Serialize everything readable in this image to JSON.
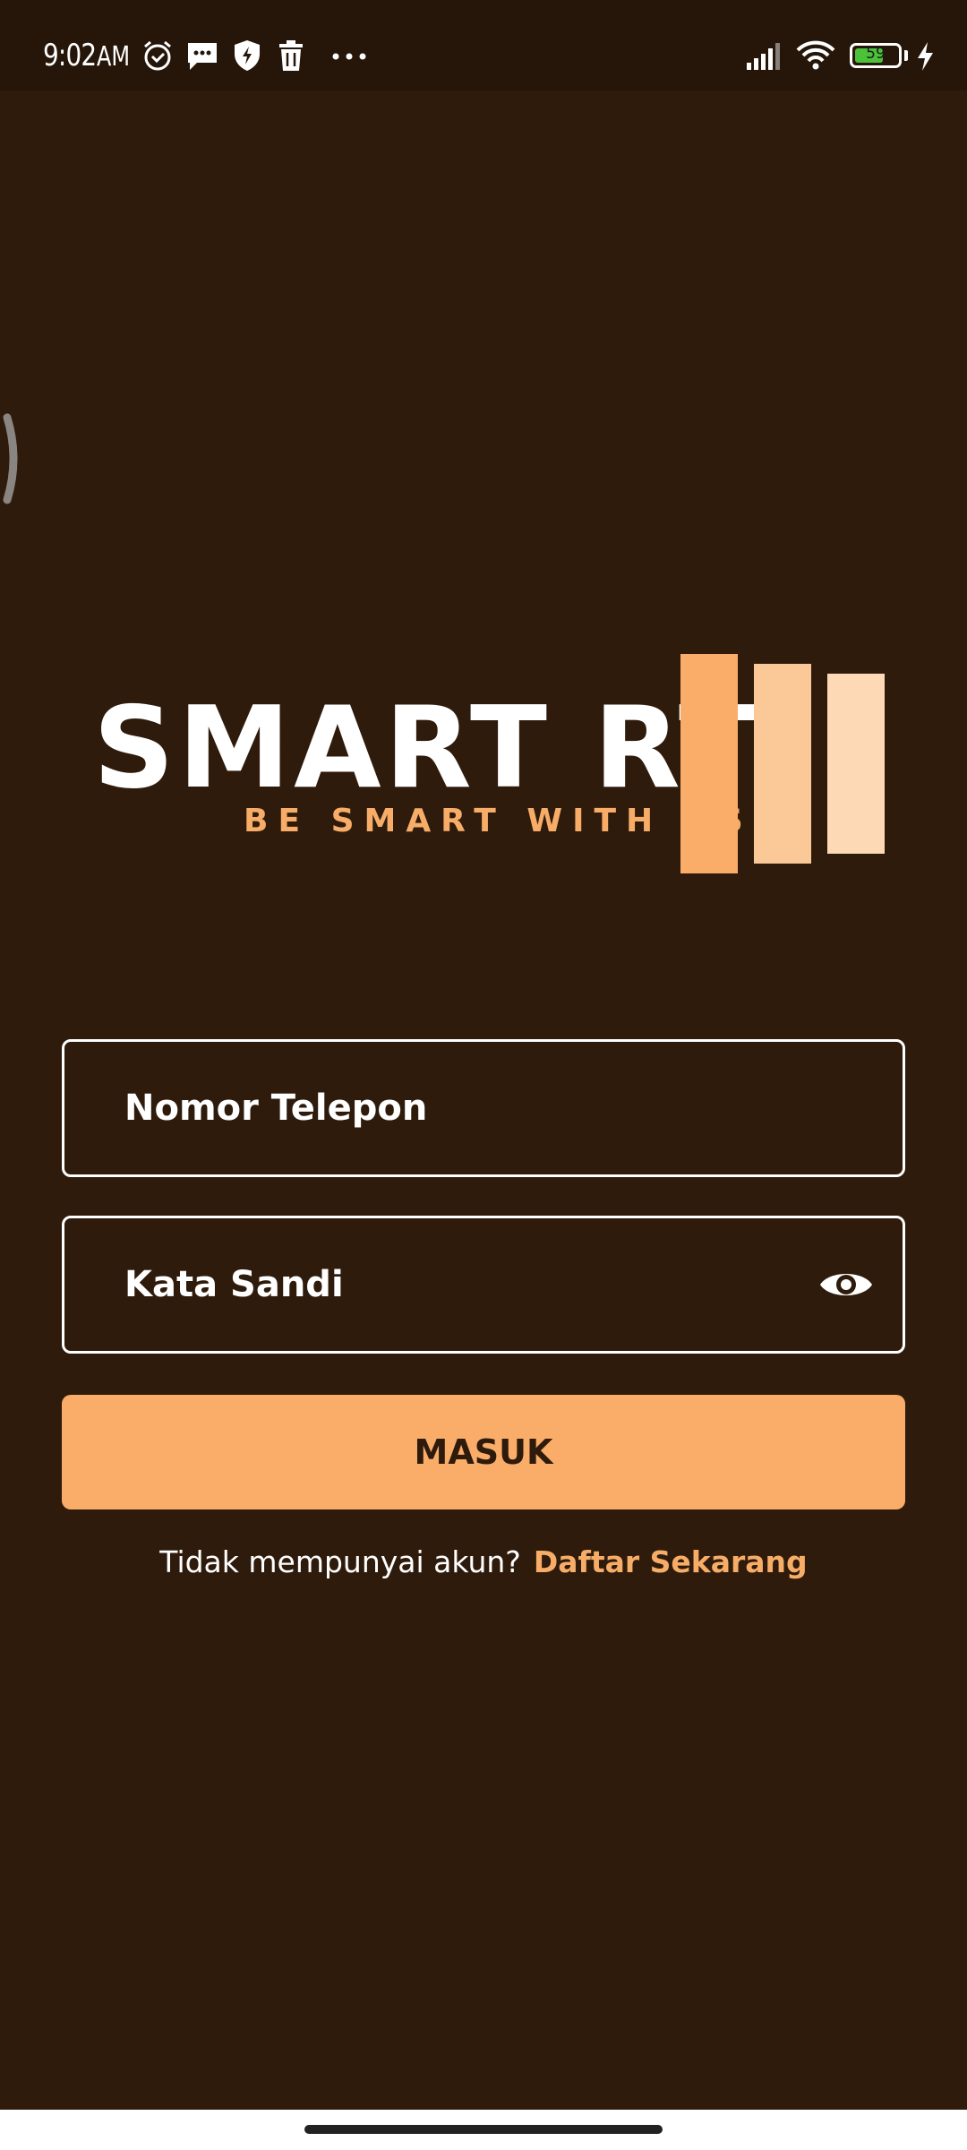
{
  "status_bar": {
    "time": "9:02",
    "ampm": "AM",
    "battery_level": "59",
    "icons": [
      "alarm-icon",
      "message-icon",
      "shield-icon",
      "trash-icon",
      "more-dots-icon",
      "signal-icon",
      "wifi-icon",
      "battery-icon",
      "charging-icon"
    ]
  },
  "logo": {
    "title": "SMART RT",
    "tagline": "BE SMART WITH US",
    "bar_colors": [
      "#f9ad68",
      "#fbc898",
      "#fdd9b6"
    ]
  },
  "form": {
    "phone_label": "Nomor Telepon",
    "password_label": "Kata Sandi",
    "password_toggle_icon": "eye-icon",
    "submit_label": "MASUK"
  },
  "register": {
    "prompt": "Tidak mempunyai akun?",
    "link": "Daftar Sekarang"
  },
  "colors": {
    "background": "#2e1b0c",
    "accent": "#f9ad68",
    "text": "#ffffff"
  }
}
